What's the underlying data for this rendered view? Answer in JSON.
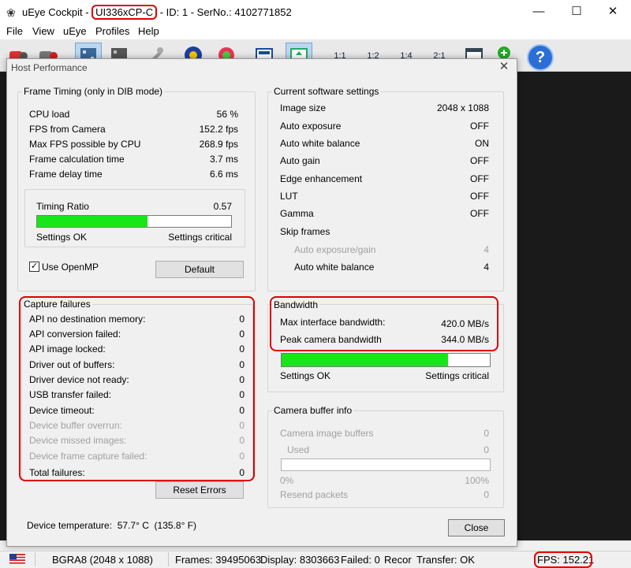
{
  "window": {
    "title_prefix": "uEye Cockpit - ",
    "model": "UI336xCP-C",
    "title_suffix": " - ID: 1 - SerNo.: 4102771852",
    "minimize": "—",
    "maximize": "☐",
    "close": "✕"
  },
  "menu": [
    "File",
    "View",
    "uEye",
    "Profiles",
    "Help"
  ],
  "toolbar": {
    "zoom_1_1": "1:1",
    "zoom_1_2": "1:2",
    "zoom_1_4": "1:4",
    "zoom_2_1": "2:1",
    "help": "?"
  },
  "dialog": {
    "title": "Host Performance",
    "close": "✕",
    "frame_timing": {
      "title": "Frame Timing (only in DIB mode)",
      "rows": [
        {
          "label": "CPU load",
          "value": "56 %"
        },
        {
          "label": "FPS from Camera",
          "value": "152.2 fps"
        },
        {
          "label": "Max FPS possible by CPU",
          "value": "268.9 fps"
        },
        {
          "label": "Frame calculation time",
          "value": "3.7 ms"
        },
        {
          "label": "Frame delay time",
          "value": "6.6 ms"
        }
      ],
      "timing_ratio_label": "Timing Ratio",
      "timing_ratio_value": "0.57",
      "timing_ratio": 0.57,
      "settings_ok": "Settings OK",
      "settings_critical": "Settings critical",
      "use_openmp": "Use OpenMP",
      "use_openmp_checked": true,
      "default_button": "Default"
    },
    "software_settings": {
      "title": "Current software settings",
      "rows": [
        {
          "label": "Image size",
          "value": "2048 x 1088"
        },
        {
          "label": "Auto exposure",
          "value": "OFF"
        },
        {
          "label": "Auto white balance",
          "value": "ON"
        },
        {
          "label": "Auto gain",
          "value": "OFF"
        },
        {
          "label": "Edge enhancement",
          "value": "OFF"
        },
        {
          "label": "LUT",
          "value": "OFF"
        },
        {
          "label": "Gamma",
          "value": "OFF"
        }
      ],
      "skip_frames_label": "Skip frames",
      "skip_rows": [
        {
          "label": "Auto exposure/gain",
          "value": "4"
        },
        {
          "label": "Auto white balance",
          "value": "4"
        }
      ]
    },
    "capture_failures": {
      "title": "Capture failures",
      "rows": [
        {
          "label": "API no destination memory:",
          "value": "0"
        },
        {
          "label": "API conversion failed:",
          "value": "0"
        },
        {
          "label": "API image locked:",
          "value": "0"
        },
        {
          "label": "Driver out of buffers:",
          "value": "0"
        },
        {
          "label": "Driver device not ready:",
          "value": "0"
        },
        {
          "label": "USB transfer failed:",
          "value": "0"
        },
        {
          "label": "Device timeout:",
          "value": "0"
        }
      ],
      "disabled_rows": [
        {
          "label": "Device buffer overrun:",
          "value": "0"
        },
        {
          "label": "Device missed images:",
          "value": "0"
        },
        {
          "label": "Device frame capture failed:",
          "value": "0"
        }
      ],
      "total_label": "Total failures:",
      "total_value": "0",
      "reset_button": "Reset Errors"
    },
    "bandwidth": {
      "title": "Bandwidth",
      "rows": [
        {
          "label": "Max interface bandwidth:",
          "value": "420.0 MB/s"
        },
        {
          "label": "Peak camera bandwidth",
          "value": "344.0 MB/s"
        }
      ],
      "usage_ratio": 0.8,
      "settings_ok": "Settings OK",
      "settings_critical": "Settings critical"
    },
    "camera_buffer": {
      "title": "Camera buffer info",
      "image_buffers_label": "Camera image buffers",
      "image_buffers_value": "0",
      "used_label": "Used",
      "used_value": "0",
      "pct_min": "0%",
      "pct_max": "100%",
      "resend_label": "Resend packets",
      "resend_value": "0"
    },
    "device_temperature": "Device temperature:  57.7° C  (135.8° F)",
    "close_button": "Close"
  },
  "statusbar": {
    "format": "BGRA8 (2048 x 1088)",
    "frames": "Frames: 39495063",
    "display": "Display: 8303663",
    "failed": "Failed: 0",
    "recor": "Recor",
    "transfer": "Transfer: OK",
    "fps": "FPS: 152.21"
  },
  "colors": {
    "bar_fill": "#19e619",
    "highlight": "#e00000",
    "viewer_bg": "#1a1a1a"
  }
}
